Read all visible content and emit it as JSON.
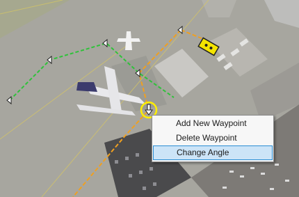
{
  "context_menu": {
    "items": [
      {
        "label": "Add New Waypoint",
        "highlighted": false
      },
      {
        "label": "Delete Waypoint",
        "highlighted": false
      },
      {
        "label": "Change Angle",
        "highlighted": true
      }
    ]
  },
  "colors": {
    "route_green": "#2fc23a",
    "route_orange": "#f0a020",
    "selection_ring": "#ffee00",
    "menu_highlight": "#cce4f7",
    "menu_highlight_border": "#2a8dd4"
  },
  "icons": [
    "waypoint-arrow-icon",
    "selected-waypoint-icon",
    "aircraft-icon",
    "vehicle-icon"
  ]
}
